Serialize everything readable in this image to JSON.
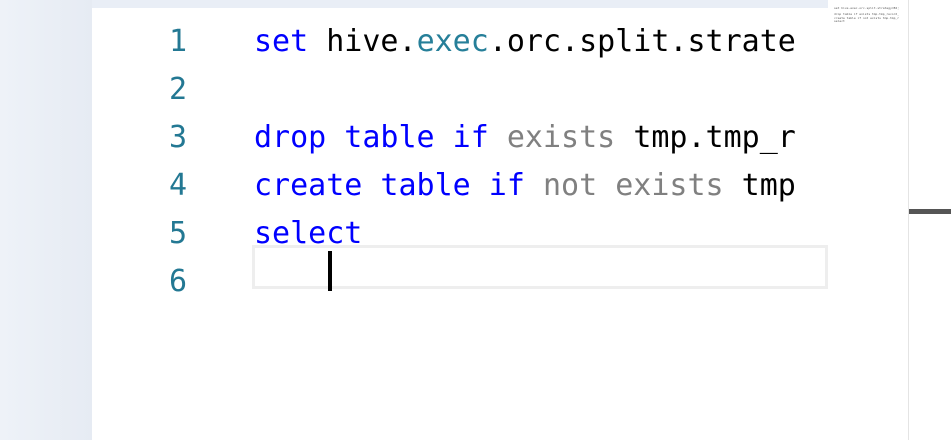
{
  "editor": {
    "lines": [
      {
        "number": "1",
        "tokens": [
          {
            "text": "set ",
            "cls": "kw"
          },
          {
            "text": "hive.",
            "cls": ""
          },
          {
            "text": "exec",
            "cls": "pr"
          },
          {
            "text": ".orc.split.strate",
            "cls": ""
          }
        ]
      },
      {
        "number": "2",
        "tokens": []
      },
      {
        "number": "3",
        "tokens": [
          {
            "text": "drop table if ",
            "cls": "kw"
          },
          {
            "text": "exists ",
            "cls": "mu"
          },
          {
            "text": "tmp.tmp_r",
            "cls": ""
          }
        ]
      },
      {
        "number": "4",
        "tokens": [
          {
            "text": "create table if ",
            "cls": "kw"
          },
          {
            "text": "not exists ",
            "cls": "mu"
          },
          {
            "text": "tmp",
            "cls": ""
          }
        ]
      },
      {
        "number": "5",
        "tokens": [
          {
            "text": "select",
            "cls": "kw"
          }
        ]
      },
      {
        "number": "6",
        "tokens": []
      }
    ]
  },
  "minimap": {
    "lines": [
      "set hive.exec.orc.split.strategy=BI;",
      "",
      "drop table if exists tmp.tmp_record_",
      "create table if not exists tmp.tmp_r",
      "select"
    ]
  }
}
